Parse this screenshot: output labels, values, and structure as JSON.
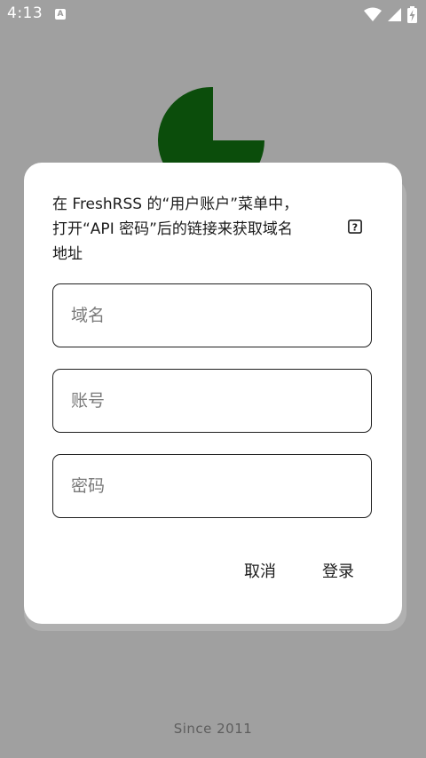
{
  "status_bar": {
    "time": "4:13",
    "notification_icon": "A",
    "icons": [
      "wifi-icon",
      "signal-icon",
      "battery-charging-icon"
    ]
  },
  "dialog": {
    "message": "在 FreshRSS 的“用户账户”菜单中，\n打开“API 密码”后的链接来获取域名\n地址",
    "help_icon": "?",
    "fields": {
      "domain_placeholder": "域名",
      "account_placeholder": "账号",
      "password_placeholder": "密码"
    },
    "buttons": {
      "cancel": "取消",
      "login": "登录"
    }
  },
  "footer": {
    "since": "Since 2011"
  },
  "colors": {
    "background": "#a0a0a0",
    "logo_green": "#0b4d0b",
    "dialog_bg": "#ffffff"
  }
}
